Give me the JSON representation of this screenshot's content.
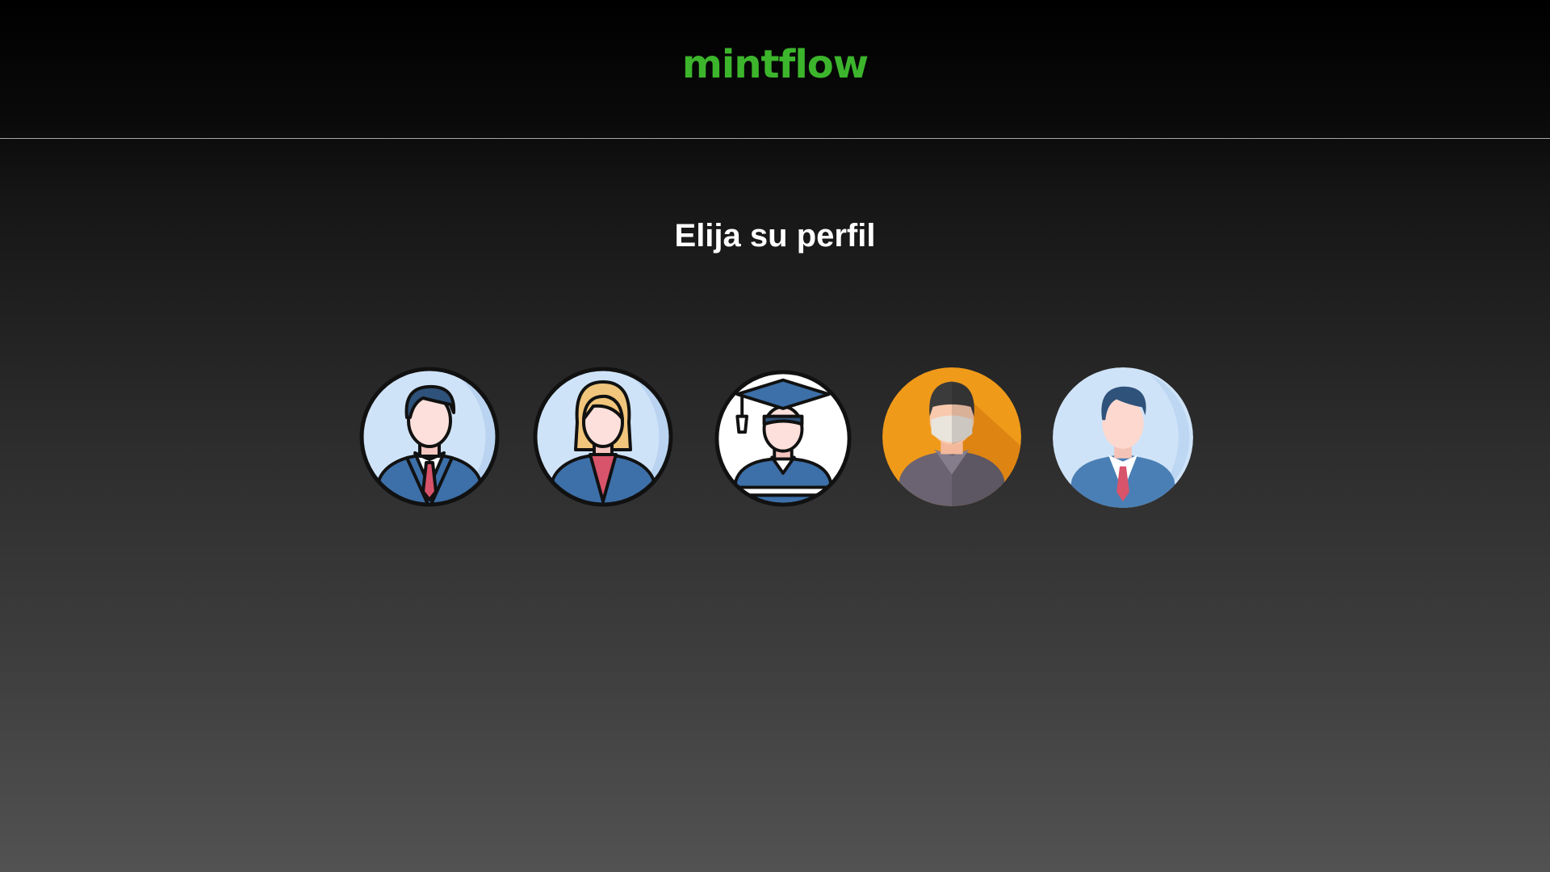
{
  "header": {
    "brand": "mintflow"
  },
  "main": {
    "title": "Elija su perfil",
    "profiles": [
      {
        "icon": "businessman-avatar-icon",
        "color": "#cfe3f8"
      },
      {
        "icon": "businesswoman-avatar-icon",
        "color": "#cfe3f8"
      },
      {
        "icon": "graduate-student-avatar-icon",
        "color": "#ffffff"
      },
      {
        "icon": "masked-person-avatar-icon",
        "color": "#f09a1a"
      },
      {
        "icon": "executive-avatar-icon",
        "color": "#cfe3f8"
      }
    ]
  },
  "colors": {
    "brand": "#3cb52c",
    "divider": "#a8a8a8"
  }
}
